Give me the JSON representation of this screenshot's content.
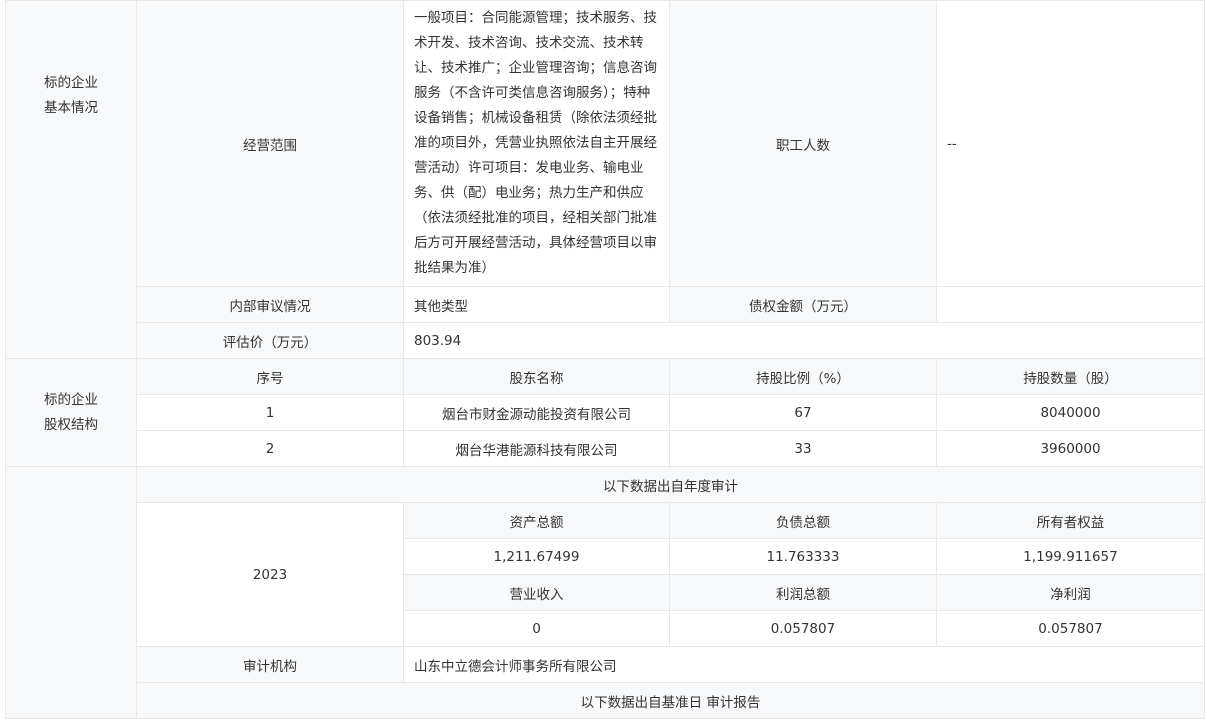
{
  "basic": {
    "group_label": [
      "标的企业",
      "基本情况"
    ],
    "business_scope_label": "经营范围",
    "business_scope": "一般项目：合同能源管理；技术服务、技术开发、技术咨询、技术交流、技术转让、技术推广；企业管理咨询；信息咨询服务（不含许可类信息咨询服务）；特种设备销售；机械设备租赁（除依法须经批准的项目外，凭营业执照依法自主开展经营活动）许可项目：发电业务、输电业务、供（配）电业务；热力生产和供应（依法须经批准的项目，经相关部门批准后方可开展经营活动，具体经营项目以审批结果为准）",
    "employees_label": "职工人数",
    "employees_value": "--",
    "internal_review_label": "内部审议情况",
    "internal_review_value": "其他类型",
    "debt_label": "债权金额（万元）",
    "debt_value": "",
    "valuation_label": "评估价（万元）",
    "valuation_value": "803.94"
  },
  "equity": {
    "group_label": [
      "标的企业",
      "股权结构"
    ],
    "headers": [
      "序号",
      "股东名称",
      "持股比例（%）",
      "持股数量（股）"
    ],
    "rows": [
      [
        "1",
        "烟台市财金源动能投资有限公司",
        "67",
        "8040000"
      ],
      [
        "2",
        "烟台华港能源科技有限公司",
        "33",
        "3960000"
      ]
    ]
  },
  "finance": {
    "annual_banner": "以下数据出自年度审计",
    "year": "2023",
    "headers_a": [
      "资产总额",
      "负债总额",
      "所有者权益"
    ],
    "values_a": [
      "1,211.67499",
      "11.763333",
      "1,199.911657"
    ],
    "headers_b": [
      "营业收入",
      "利润总额",
      "净利润"
    ],
    "values_b": [
      "0",
      "0.057807",
      "0.057807"
    ],
    "auditor_label": "审计机构",
    "auditor_value": "山东中立德会计师事务所有限公司",
    "base_banner": "以下数据出自基准日 审计报告"
  }
}
